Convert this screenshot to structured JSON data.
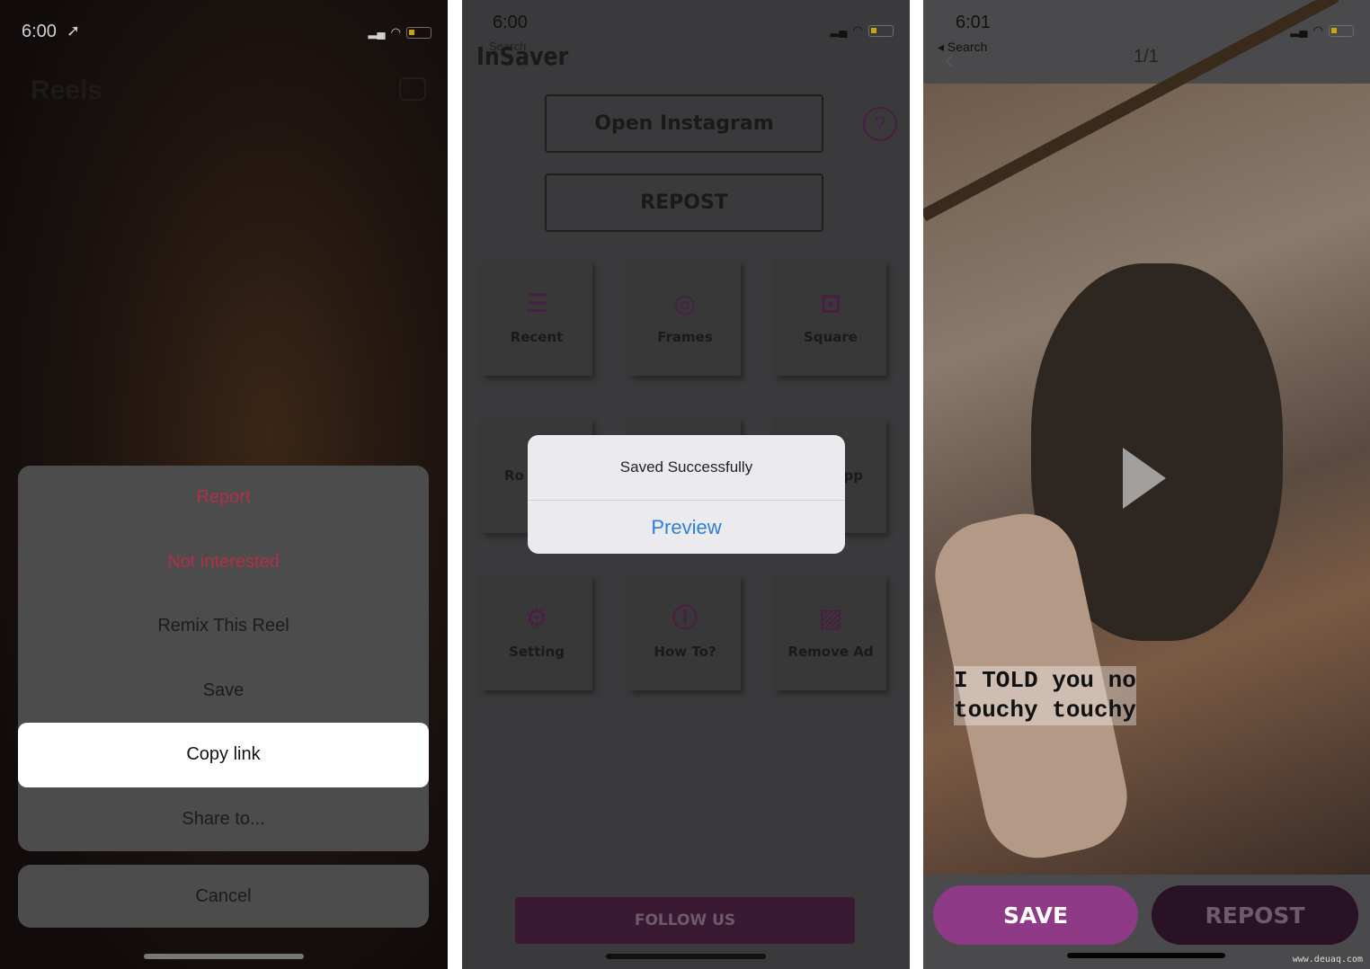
{
  "panel1": {
    "time": "6:00",
    "title": "Reels",
    "menu": [
      "Report",
      "Not interested",
      "Remix This Reel",
      "Save",
      "Copy link",
      "Share to..."
    ],
    "cancel": "Cancel"
  },
  "panel2": {
    "time": "6:00",
    "back": "Search",
    "app_title": "InSaver",
    "open_instagram": "Open Instagram",
    "repost": "REPOST",
    "help": "?",
    "grid": [
      {
        "label": "Recent",
        "icon": "list-icon"
      },
      {
        "label": "Frames",
        "icon": "frames-icon"
      },
      {
        "label": "Square",
        "icon": "square-icon"
      },
      {
        "label": "Ro",
        "icon": ""
      },
      {
        "label": "",
        "icon": ""
      },
      {
        "label": "pp",
        "icon": ""
      },
      {
        "label": "Setting",
        "icon": "gear-icon"
      },
      {
        "label": "How To?",
        "icon": "question-icon"
      },
      {
        "label": "Remove Ad",
        "icon": "ad-icon"
      }
    ],
    "alert": {
      "message": "Saved Successfully",
      "action": "Preview"
    },
    "follow": "FOLLOW US"
  },
  "panel3": {
    "time": "6:01",
    "back": "Search",
    "counter": "1/1",
    "caption_line1": "I TOLD you no",
    "caption_line2": "touchy touchy",
    "save": "SAVE",
    "repost": "REPOST"
  },
  "watermark": "www.deuaq.com",
  "colors": {
    "accent_purple": "#8e3a87",
    "dark_purple": "#2a1226",
    "ios_blue": "#2f7fd6",
    "destructive": "#b0304a"
  }
}
